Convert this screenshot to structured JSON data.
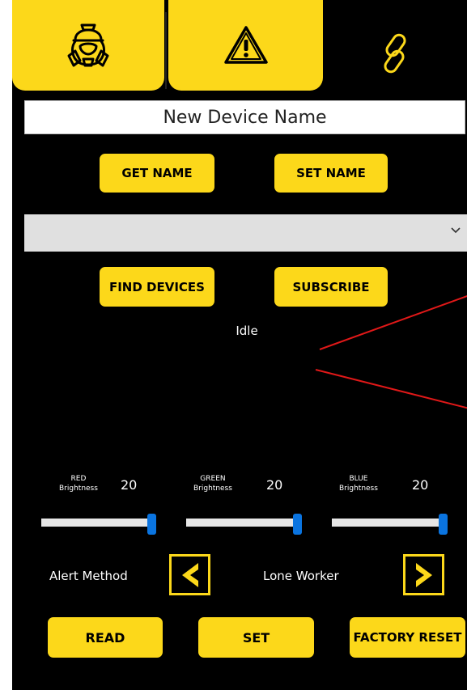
{
  "tabs": [
    {
      "name": "respirator",
      "icon": "respirator-mask-icon",
      "active": false
    },
    {
      "name": "alerts",
      "icon": "warning-triangle-icon",
      "active": false
    },
    {
      "name": "link",
      "icon": "chain-link-icon",
      "active": true
    }
  ],
  "device_name": {
    "value": "New Device Name",
    "placeholder": ""
  },
  "buttons": {
    "get_name": "GET NAME",
    "set_name": "SET NAME",
    "find_devices": "FIND DEVICES",
    "subscribe": "SUBSCRIBE",
    "read": "READ",
    "set": "SET",
    "factory_reset": "FACTORY RESET"
  },
  "device_select": {
    "selected": "",
    "icon": "chevron-down-icon"
  },
  "status": "Idle",
  "sliders": {
    "red": {
      "label_top": "RED",
      "label_bottom": "Brightness",
      "value": "20",
      "fraction": 1.0
    },
    "green": {
      "label_top": "GREEN",
      "label_bottom": "Brightness",
      "value": "20",
      "fraction": 1.0
    },
    "blue": {
      "label_top": "BLUE",
      "label_bottom": "Brightness",
      "value": "20",
      "fraction": 1.0
    }
  },
  "alert": {
    "label": "Alert Method",
    "value": "Lone Worker"
  },
  "colors": {
    "accent": "#fcd81a",
    "background": "#000000",
    "slider_thumb": "#0a74e0",
    "annotation": "#e01818"
  }
}
